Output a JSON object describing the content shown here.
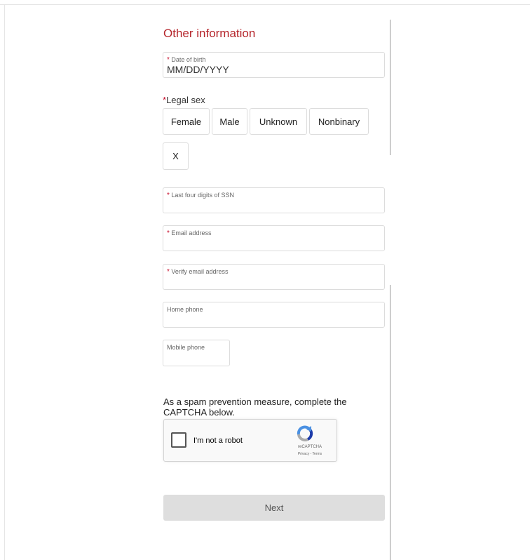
{
  "section": {
    "title": "Other information"
  },
  "dob": {
    "label": "Date of birth",
    "placeholder": "MM/DD/YYYY",
    "required": true
  },
  "legal_sex": {
    "label": "Legal sex",
    "required": true,
    "options": [
      "Female",
      "Male",
      "Unknown",
      "Nonbinary",
      "X"
    ]
  },
  "ssn": {
    "label": "Last four digits of SSN",
    "required": true
  },
  "email": {
    "label": "Email address",
    "required": true
  },
  "verify_email": {
    "label": "Verify email address",
    "required": true
  },
  "home_phone": {
    "label": "Home phone"
  },
  "mobile_phone": {
    "label": "Mobile phone"
  },
  "spam_text": "As a spam prevention measure, complete the CAPTCHA below.",
  "captcha": {
    "label": "I'm not a robot",
    "brand": "reCAPTCHA",
    "terms": "Privacy - Terms"
  },
  "next_label": "Next",
  "colors": {
    "accent": "#b5262c",
    "required": "#c8102e",
    "button_bg": "#dedede"
  }
}
